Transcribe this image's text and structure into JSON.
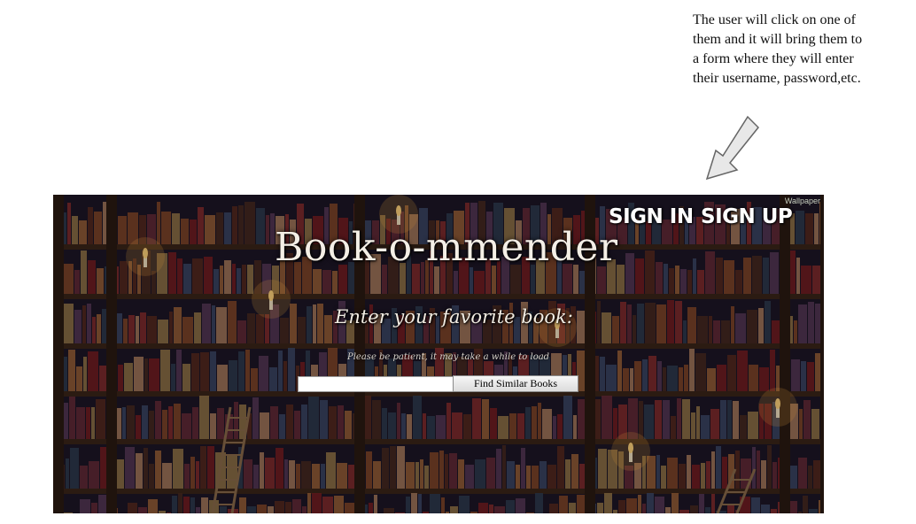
{
  "annotation": {
    "lines": [
      "The user will click on one of",
      "them and it will bring them to",
      "a form where they will enter",
      "their username, password,etc."
    ]
  },
  "header": {
    "sign_in_label": "SIGN IN",
    "sign_up_label": "SIGN UP",
    "watermark": "Wallpaper"
  },
  "main": {
    "title": "Book-o-mmender",
    "prompt": "Enter your favorite book:",
    "notice": "Please be patient, it may take a while to load",
    "search_value": "",
    "find_button_label": "Find Similar Books"
  },
  "colors": {
    "shelf_wood": "#3a2418",
    "background_dark": "#1c1626",
    "candle_glow": "#ffb347"
  }
}
